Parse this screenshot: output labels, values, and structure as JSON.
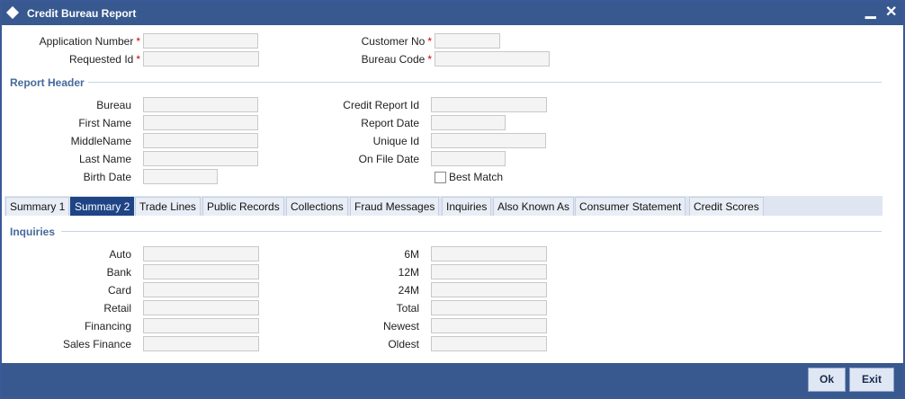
{
  "window": {
    "title": "Credit Bureau Report",
    "minimize": "‗",
    "close": "✕"
  },
  "header_fields": {
    "application_number": {
      "label": "Application Number",
      "required": "*"
    },
    "requested_id": {
      "label": "Requested Id",
      "required": "*"
    },
    "customer_no": {
      "label": "Customer No",
      "required": "*"
    },
    "bureau_code": {
      "label": "Bureau Code",
      "required": "*"
    }
  },
  "report_header": {
    "section_title": "Report Header",
    "bureau": "Bureau",
    "first_name": "First Name",
    "middle_name": "MiddleName",
    "last_name": "Last Name",
    "birth_date": "Birth Date",
    "credit_report_id": "Credit Report Id",
    "report_date": "Report Date",
    "unique_id": "Unique Id",
    "on_file_date": "On File Date",
    "best_match": "Best Match"
  },
  "tabs": [
    {
      "label": "Summary 1"
    },
    {
      "label": "Summary 2"
    },
    {
      "label": "Trade Lines"
    },
    {
      "label": "Public Records"
    },
    {
      "label": "Collections"
    },
    {
      "label": "Fraud Messages"
    },
    {
      "label": "Inquiries"
    },
    {
      "label": "Also Known As"
    },
    {
      "label": "Consumer Statement"
    },
    {
      "label": "Credit Scores"
    }
  ],
  "active_tab": "Summary 2",
  "inquiries": {
    "section_title": "Inquiries",
    "left": [
      "Auto",
      "Bank",
      "Card",
      "Retail",
      "Financing",
      "Sales Finance"
    ],
    "right": [
      "6M",
      "12M",
      "24M",
      "Total",
      "Newest",
      "Oldest"
    ]
  },
  "footer": {
    "ok": "Ok",
    "exit": "Exit"
  },
  "colors": {
    "titlebar": "#38598f",
    "active_tab": "#1f4486",
    "section_title": "#46699c",
    "required": "#cc0000"
  }
}
